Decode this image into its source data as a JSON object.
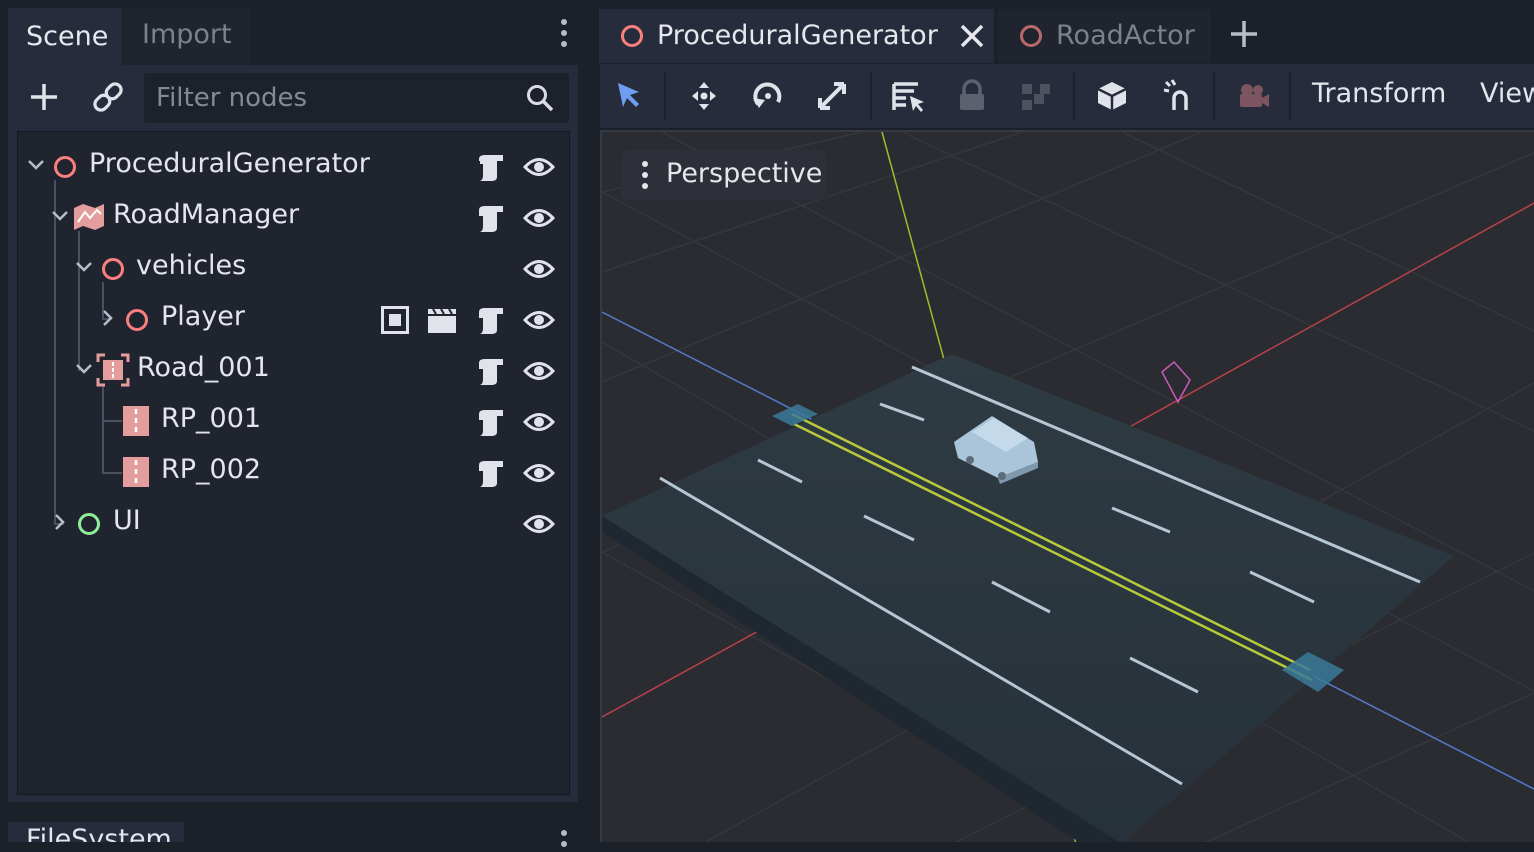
{
  "scene_dock": {
    "tabs": [
      {
        "label": "Scene",
        "active": true
      },
      {
        "label": "Import",
        "active": false
      }
    ],
    "filter": {
      "placeholder": "Filter nodes",
      "value": ""
    },
    "icons": {
      "add": "plus-icon",
      "link": "link-icon",
      "search": "search-icon",
      "menu": "kebab-menu-icon"
    },
    "tree": [
      {
        "label": "ProceduralGenerator",
        "icon": "node3d-icon",
        "expanded": true,
        "script": true,
        "visible": true
      },
      {
        "label": "RoadManager",
        "icon": "road-manager-icon",
        "expanded": true,
        "script": true,
        "visible": true
      },
      {
        "label": "vehicles",
        "icon": "node3d-icon",
        "expanded": true,
        "script": false,
        "visible": true
      },
      {
        "label": "Player",
        "icon": "node3d-icon",
        "expanded": false,
        "script": true,
        "visible": true,
        "extra_icons": [
          "instance-icon",
          "clapperboard-icon"
        ]
      },
      {
        "label": "Road_001",
        "icon": "road-container-icon",
        "expanded": true,
        "script": true,
        "visible": true
      },
      {
        "label": "RP_001",
        "icon": "road-point-icon",
        "script": true,
        "visible": true
      },
      {
        "label": "RP_002",
        "icon": "road-point-icon",
        "script": true,
        "visible": true
      },
      {
        "label": "UI",
        "icon": "control-node-icon",
        "expanded": false,
        "script": false,
        "visible": true
      }
    ]
  },
  "bottom_dock": {
    "label": "FileSystem"
  },
  "editor": {
    "tabs": [
      {
        "label": "ProceduralGenerator",
        "active": true,
        "closable": true
      },
      {
        "label": "RoadActor",
        "active": false
      }
    ],
    "toolbar": {
      "tools": [
        "select-icon",
        "move-icon",
        "rotate-icon",
        "scale-icon",
        "list-select-icon",
        "lock-icon",
        "group-icon",
        "local-space-icon",
        "snap-icon",
        "camera-icon"
      ],
      "menus": [
        "Transform",
        "View"
      ]
    },
    "viewport": {
      "mode_label": "Perspective"
    }
  },
  "colors": {
    "accent": "#6f9df1",
    "node3d": "#fc7f7f",
    "control": "#8eef97",
    "road_marker": "#e39d9d",
    "background": "#1c2029",
    "panel": "#262c3b"
  }
}
